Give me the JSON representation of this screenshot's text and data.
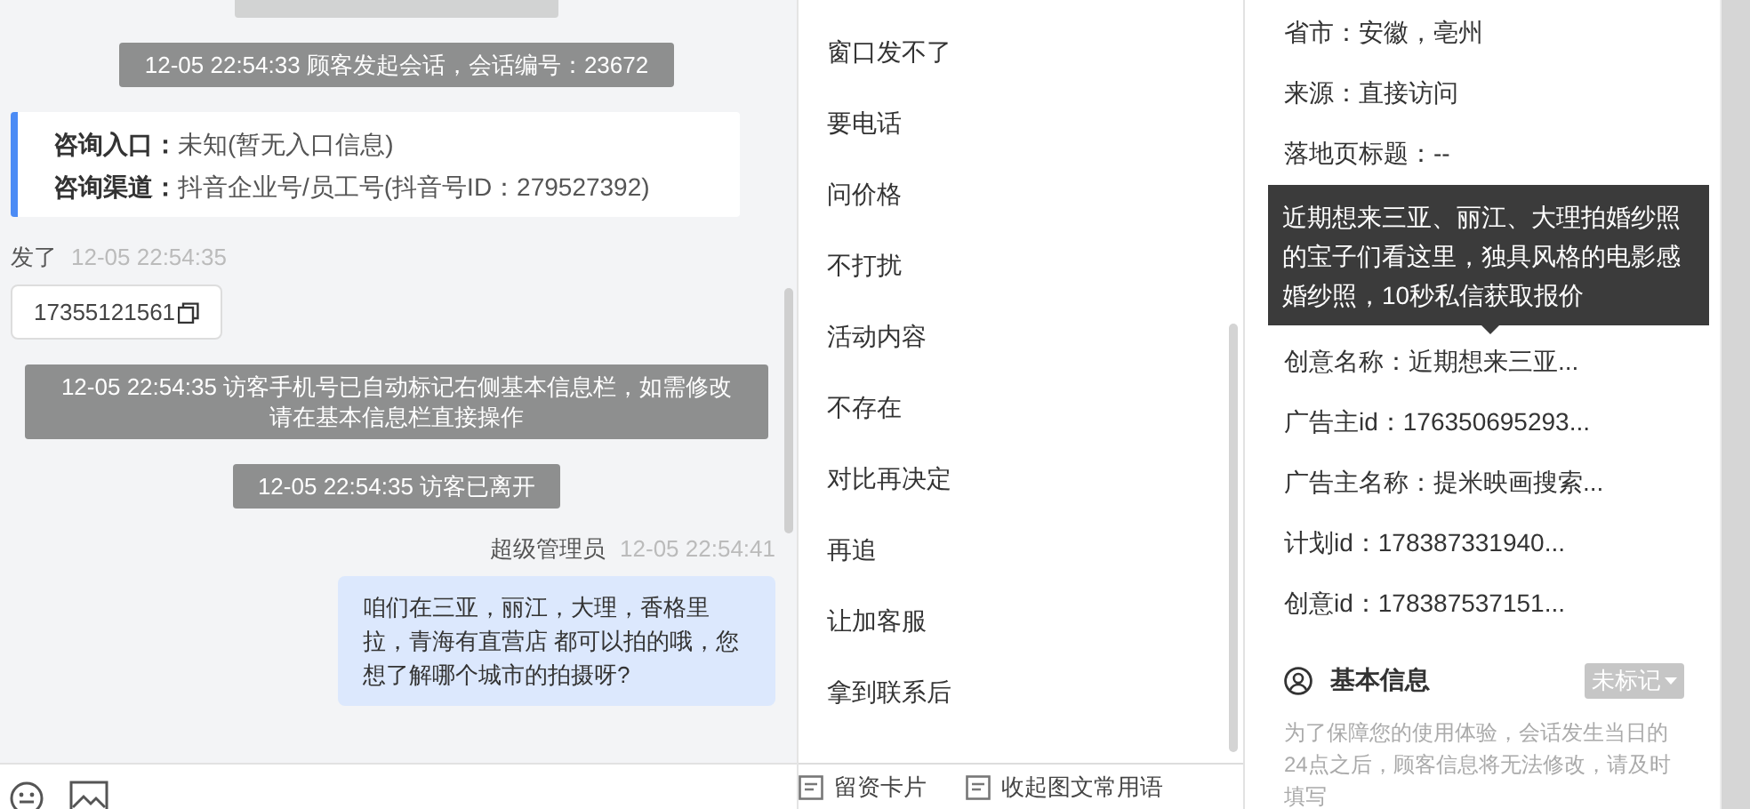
{
  "chat": {
    "messages": [
      {
        "kind": "system_cut"
      },
      {
        "kind": "system",
        "text": "12-05 22:54:33 顾客发起会话，会话编号：23672"
      },
      {
        "kind": "entry_card",
        "rows": [
          {
            "label": "咨询入口：",
            "value": "未知(暂无入口信息)"
          },
          {
            "label": "咨询渠道：",
            "value": "抖音企业号/员工号(抖音号ID：279527392)"
          }
        ]
      },
      {
        "kind": "visitor",
        "sender": "发了",
        "time": "12-05 22:54:35",
        "text": "17355121561"
      },
      {
        "kind": "system",
        "text": "12-05 22:54:35 访客手机号已自动标记右侧基本信息栏，如需修改请在基本信息栏直接操作"
      },
      {
        "kind": "system",
        "text": "12-05 22:54:35 访客已离开"
      },
      {
        "kind": "agent",
        "sender": "超级管理员",
        "time": "12-05 22:54:41",
        "text": "咱们在三亚，丽江，大理，香格里拉，青海有直营店 都可以拍的哦，您想了解哪个城市的拍摄呀?"
      }
    ]
  },
  "phrases": {
    "items": [
      "窗口发不了",
      "要电话",
      "问价格",
      "不打扰",
      "活动内容",
      "不存在",
      "对比再决定",
      "再追",
      "让加客服",
      "拿到联系后"
    ],
    "footer": [
      "留资卡片",
      "收起图文常用语"
    ]
  },
  "info": {
    "rows": [
      {
        "kind": "row",
        "text": "省市：安徽，亳州"
      },
      {
        "kind": "row",
        "text": "来源：直接访问"
      },
      {
        "kind": "row",
        "text": "落地页标题：--"
      },
      {
        "kind": "tooltip",
        "text": "近期想来三亚、丽江、大理拍婚纱照的宝子们看这里，独具风格的电影感婚纱照，10秒私信获取报价"
      },
      {
        "kind": "row",
        "text": "创意名称：近期想来三亚..."
      },
      {
        "kind": "row",
        "text": "广告主id：176350695293..."
      },
      {
        "kind": "row",
        "text": "广告主名称：提米映画搜索..."
      },
      {
        "kind": "row",
        "text": "计划id：178387331940..."
      },
      {
        "kind": "row",
        "text": "创意id：178387537151..."
      }
    ],
    "section": {
      "title": "基本信息",
      "tag": "未标记",
      "note": "为了保障您的使用体验，会话发生当日的24点之后，顾客信息将无法修改，请及时填写"
    }
  }
}
